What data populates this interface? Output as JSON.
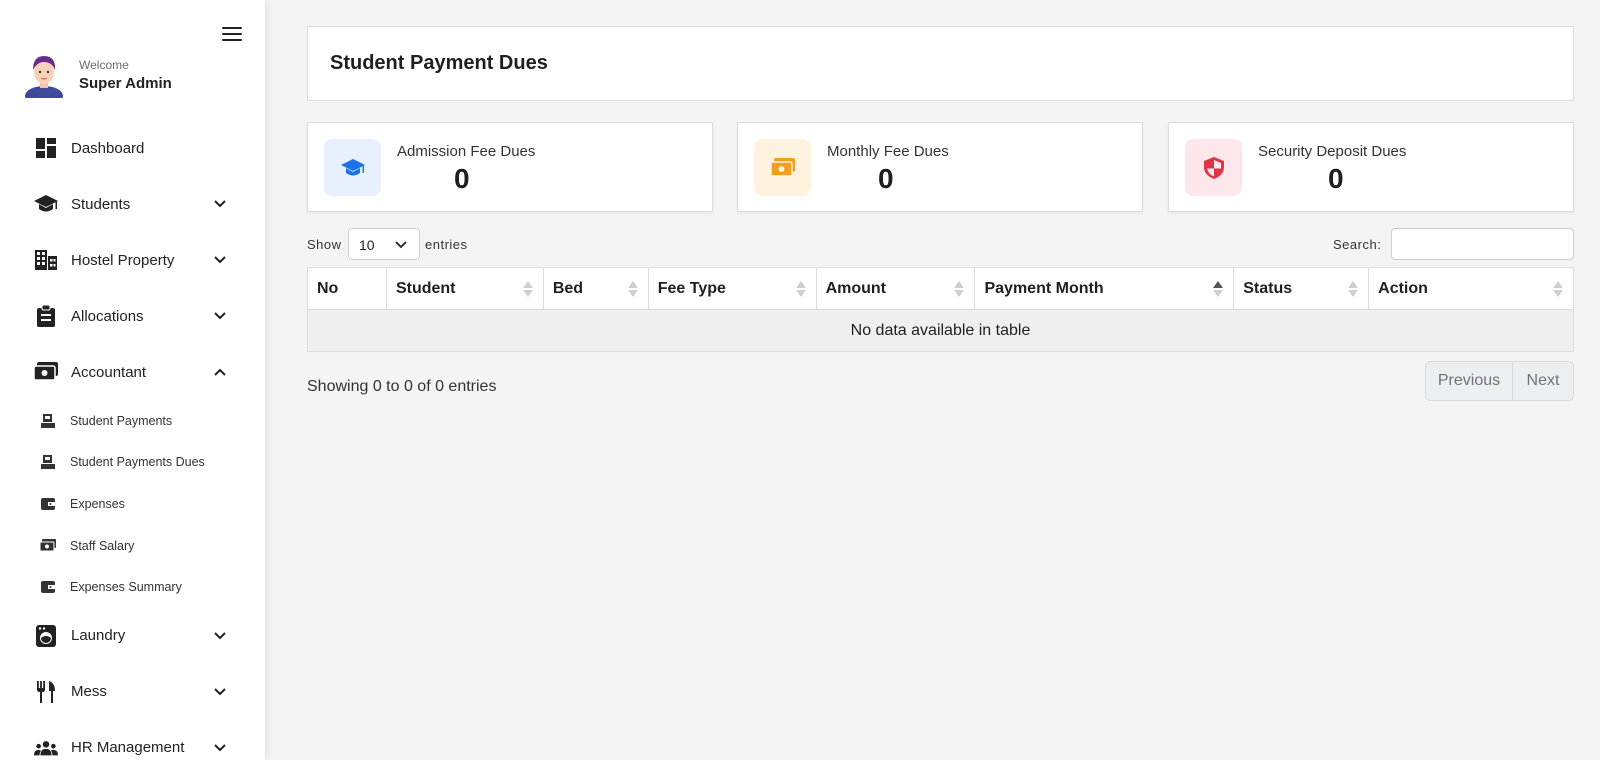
{
  "sidebar": {
    "profile": {
      "welcome": "Welcome",
      "username": "Super Admin"
    },
    "items": [
      {
        "label": "Dashboard"
      },
      {
        "label": "Students"
      },
      {
        "label": "Hostel Property"
      },
      {
        "label": "Allocations"
      },
      {
        "label": "Accountant"
      },
      {
        "label": "Laundry"
      },
      {
        "label": "Mess"
      },
      {
        "label": "HR Management"
      }
    ],
    "accountant_sub": [
      {
        "label": "Student Payments"
      },
      {
        "label": "Student Payments Dues"
      },
      {
        "label": "Expenses"
      },
      {
        "label": "Staff Salary"
      },
      {
        "label": "Expenses Summary"
      }
    ]
  },
  "page": {
    "title": "Student Payment Dues"
  },
  "stats": [
    {
      "title": "Admission Fee Dues",
      "value": "0",
      "color": "#1a73e8",
      "bg": "#e8f0fe"
    },
    {
      "title": "Monthly Fee Dues",
      "value": "0",
      "color": "#f0a020",
      "bg": "#fff3e0"
    },
    {
      "title": "Security Deposit Dues",
      "value": "0",
      "color": "#dc3545",
      "bg": "#fde7ea"
    }
  ],
  "table": {
    "show_label": "Show",
    "entries_value": "10",
    "entries_label": "entries",
    "search_label": "Search:",
    "search_value": "",
    "columns": [
      "No",
      "Student",
      "Bed",
      "Fee Type",
      "Amount",
      "Payment Month",
      "Status",
      "Action"
    ],
    "empty_message": "No data available in table",
    "info": "Showing 0 to 0 of 0 entries",
    "prev_label": "Previous",
    "next_label": "Next"
  }
}
